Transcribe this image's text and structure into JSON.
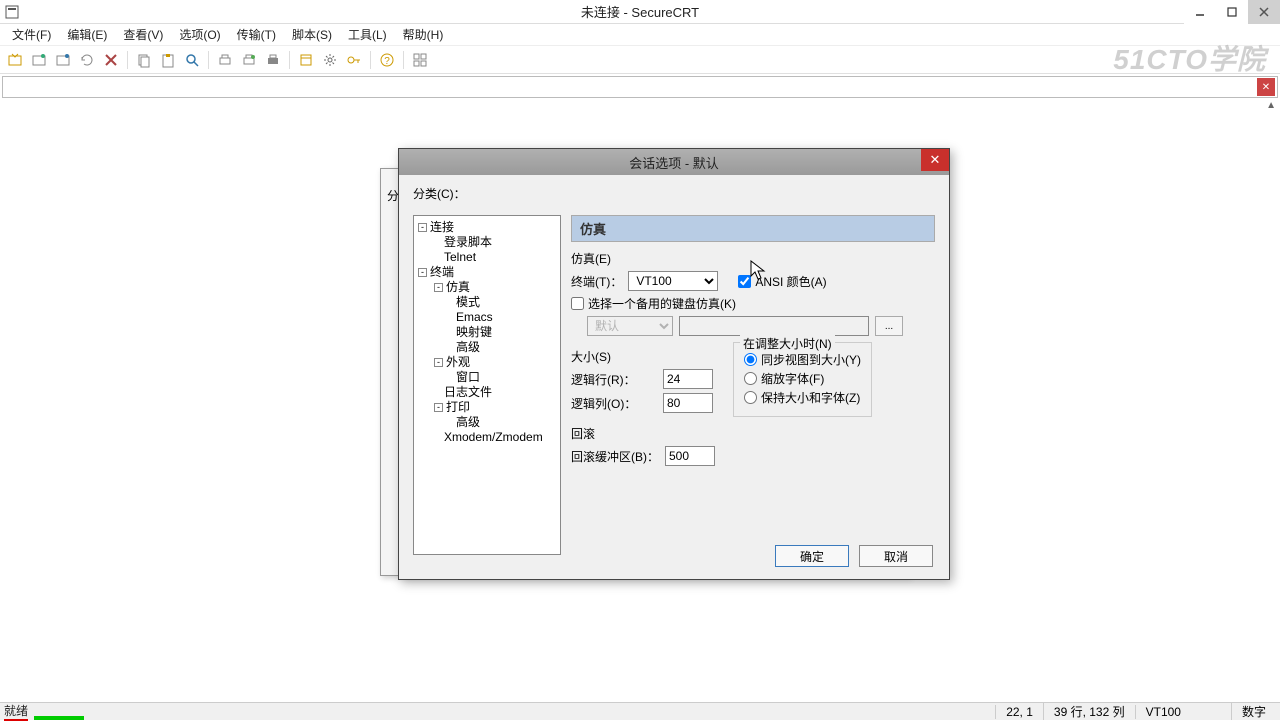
{
  "window": {
    "title": "未连接 - SecureCRT"
  },
  "menu": {
    "file": "文件(F)",
    "edit": "编辑(E)",
    "view": "查看(V)",
    "options": "选项(O)",
    "transfer": "传输(T)",
    "script": "脚本(S)",
    "tools": "工具(L)",
    "help": "帮助(H)"
  },
  "watermark": "51CTO学院",
  "bg_dialog": {
    "cat_label": "分类"
  },
  "dialog": {
    "title": "会话选项 - 默认",
    "category_label": "分类(C)：",
    "tree": {
      "connect": "连接",
      "login_script": "登录脚本",
      "telnet": "Telnet",
      "terminal": "终端",
      "emulation": "仿真",
      "mode": "模式",
      "emacs": "Emacs",
      "mapped_keys": "映射键",
      "advanced1": "高级",
      "appearance": "外观",
      "window": "窗口",
      "logfile": "日志文件",
      "printing": "打印",
      "advanced2": "高级",
      "xmodem": "Xmodem/Zmodem"
    },
    "panel": {
      "header": "仿真",
      "emulation_group": "仿真(E)",
      "terminal_label": "终端(T)：",
      "terminal_value": "VT100",
      "ansi_color": "ANSI 颜色(A)",
      "alt_keyboard": "选择一个备用的键盘仿真(K)",
      "default_kbd": "默认",
      "ellipsis": "...",
      "size_group": "大小(S)",
      "logical_rows_label": "逻辑行(R)：",
      "logical_rows_value": "24",
      "logical_cols_label": "逻辑列(O)：",
      "logical_cols_value": "80",
      "resize_group": "在调整大小时(N)",
      "sync_view": "同步视图到大小(Y)",
      "scale_font": "缩放字体(F)",
      "keep_size": "保持大小和字体(Z)",
      "scrollback_group": "回滚",
      "scrollback_label": "回滚缓冲区(B)：",
      "scrollback_value": "500"
    },
    "buttons": {
      "ok": "确定",
      "cancel": "取消"
    }
  },
  "status": {
    "ready": "就绪",
    "pos": "22,   1",
    "size": "39 行, 132 列",
    "term": "VT100",
    "num": "数字"
  }
}
